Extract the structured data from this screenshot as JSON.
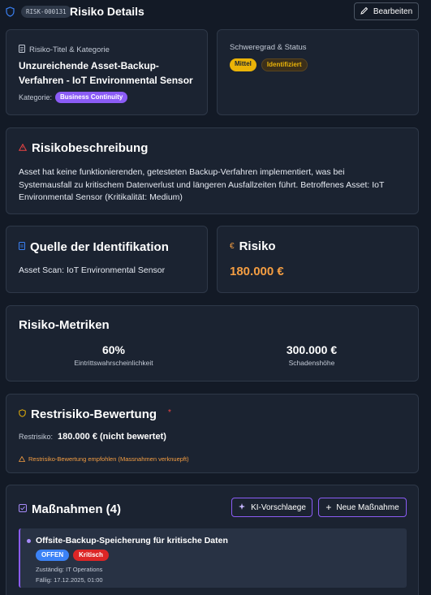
{
  "header": {
    "risk_id": "RISK-000131",
    "title": "Risiko Details",
    "edit_label": "Bearbeiten"
  },
  "title_card": {
    "label": "Risiko-Titel & Kategorie",
    "title_line1": "Unzureichende Asset-Backup-",
    "title_line2": "Verfahren - IoT Environmental Sensor",
    "category_label": "Kategorie:",
    "category_value": "Business Continuity"
  },
  "status_card": {
    "label": "Schweregrad & Status",
    "severity": "Mittel",
    "status": "Identifiziert"
  },
  "description": {
    "heading": "Risikobeschreibung",
    "line1": "Asset hat keine funktionierenden, getesteten Backup-Verfahren implementiert, was bei",
    "line2": "Systemausfall zu kritischem Datenverlust und längeren Ausfallzeiten führt. Betroffenes Asset: IoT",
    "line3": "Environmental Sensor (Kritikalität: Medium)"
  },
  "source": {
    "heading": "Quelle der Identifikation",
    "text": "Asset Scan: IoT Environmental Sensor"
  },
  "risk_value": {
    "heading": "Risiko",
    "currency_symbol": "€",
    "value": "180.000 €"
  },
  "metrics": {
    "heading": "Risiko-Metriken",
    "probability_value": "60%",
    "probability_label": "Eintrittswahrscheinlichkeit",
    "damage_value": "300.000 €",
    "damage_label": "Schadenshöhe"
  },
  "residual": {
    "heading": "Restrisiko-Bewertung",
    "required_mark": "*",
    "label": "Restrisiko:",
    "value": "180.000 € (nicht bewertet)",
    "warning": "Restrisiko-Bewertung empfohlen (Massnahmen verknuepft)"
  },
  "measures": {
    "heading": "Maßnahmen (4)",
    "ai_button": "KI-Vorschlaege",
    "new_button": "Neue Maßnahme",
    "items": [
      {
        "title": "Offsite-Backup-Speicherung für kritische Daten",
        "status": "OFFEN",
        "priority": "Kritisch",
        "responsible": "Zuständig: IT Operations",
        "due": "Fällig: 17.12.2025, 01:00"
      }
    ]
  },
  "colors": {
    "accent_purple": "#8b5cf6",
    "severity_yellow": "#eab308",
    "risk_orange": "#f59e42",
    "status_blue": "#3b82f6",
    "priority_red": "#dc2626"
  }
}
